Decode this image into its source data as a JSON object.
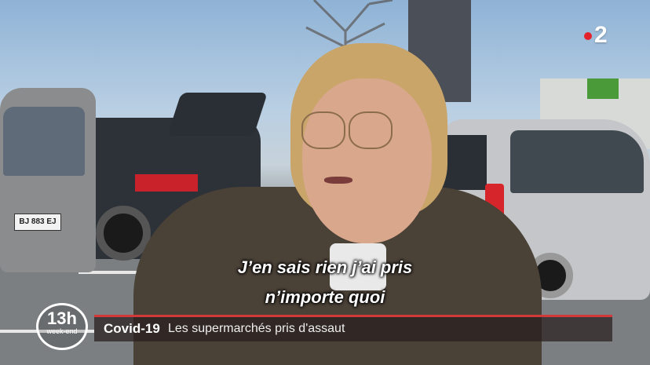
{
  "channel_logo": {
    "number": "2",
    "dot_color": "#e3232b"
  },
  "car_plate": "BJ 883 EJ",
  "subtitles": {
    "line1": "J’en sais rien j’ai pris",
    "line2": "n’importe quoi"
  },
  "banner": {
    "topic": "Covid-19",
    "headline": "Les supermarchés pris d'assaut",
    "accent_color": "#d23a3a"
  },
  "show_logo": {
    "title": "13h",
    "subtitle": "week-end"
  }
}
